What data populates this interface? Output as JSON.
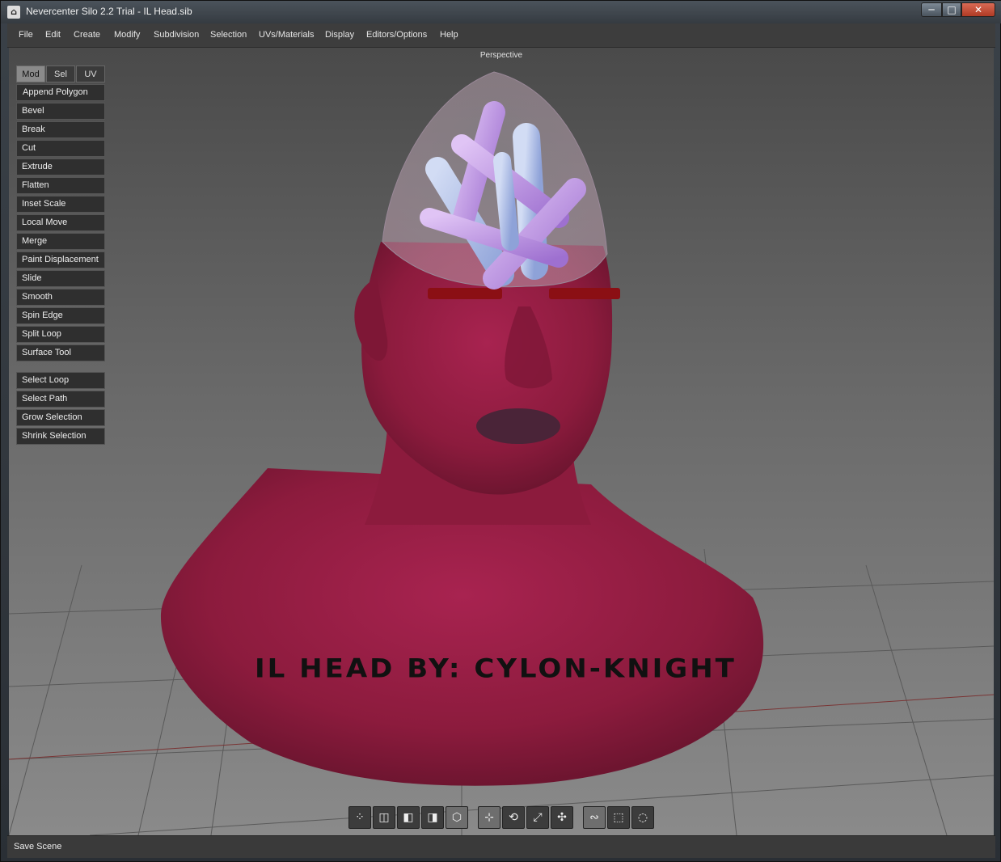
{
  "window": {
    "title": "Nevercenter Silo 2.2 Trial - IL Head.sib",
    "controls": {
      "minimize": "─",
      "maximize": "□",
      "close": "✕"
    }
  },
  "menubar": {
    "items": [
      "File",
      "Edit",
      "Create",
      "Modify",
      "Subdivision",
      "Selection",
      "UVs/Materials",
      "Display",
      "Editors/Options",
      "Help"
    ]
  },
  "viewport": {
    "label": "Perspective",
    "signature": "IL HEAD BY: CYLON-KNIGHT"
  },
  "tool_panel": {
    "tabs": [
      {
        "label": "Mod",
        "active": true
      },
      {
        "label": "Sel",
        "active": false
      },
      {
        "label": "UV",
        "active": false
      }
    ],
    "modify_tools": [
      "Append Polygon",
      "Bevel",
      "Break",
      "Cut",
      "Extrude",
      "Flatten",
      "Inset Scale",
      "Local Move",
      "Merge",
      "Paint Displacement",
      "Slide",
      "Smooth",
      "Spin Edge",
      "Split Loop",
      "Surface Tool"
    ],
    "select_tools": [
      "Select Loop",
      "Select Path",
      "Grow Selection",
      "Shrink Selection"
    ]
  },
  "bottom_toolbar": {
    "buttons": [
      {
        "icon": "vertex-select-icon",
        "active": false
      },
      {
        "icon": "edge-select-icon",
        "active": false
      },
      {
        "icon": "face-select-icon",
        "active": false
      },
      {
        "icon": "object-select-icon",
        "active": false
      },
      {
        "icon": "subdivision-cage-icon",
        "active": true
      },
      {
        "icon": "transform-move-icon",
        "active": true
      },
      {
        "icon": "transform-rotate-icon",
        "active": false
      },
      {
        "icon": "transform-scale-icon",
        "active": false
      },
      {
        "icon": "transform-universal-icon",
        "active": false
      },
      {
        "icon": "lasso-select-icon",
        "active": true
      },
      {
        "icon": "rect-select-icon",
        "active": false
      },
      {
        "icon": "paint-select-icon",
        "active": false
      }
    ]
  },
  "statusbar": {
    "text": "Save Scene"
  },
  "colors": {
    "skin": "#8c1b3d",
    "brain": "#c29ae6",
    "eyes": "#8b0f14",
    "lips": "#4a2438"
  }
}
